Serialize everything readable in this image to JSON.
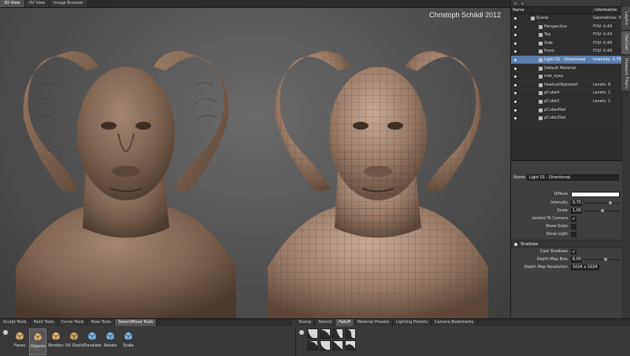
{
  "top_tabs": [
    "3D View",
    "UV View",
    "Image Browser"
  ],
  "active_top_tab": 0,
  "watermark": "Christoph Schädl 2012",
  "outliner": {
    "columns": [
      "Name",
      "Information"
    ],
    "rows": [
      {
        "name": "Scene",
        "info": "Geometries: 3",
        "indent": 0
      },
      {
        "name": "Perspective",
        "info": "FOV: 0.49",
        "indent": 1
      },
      {
        "name": "Top",
        "info": "FOV: 0.49",
        "indent": 1
      },
      {
        "name": "Side",
        "info": "FOV: 0.49",
        "indent": 1
      },
      {
        "name": "Front",
        "info": "FOV: 0.49",
        "indent": 1
      },
      {
        "name": "Light 01 - Directional",
        "info": "Intensity: 0.75",
        "indent": 1,
        "selected": true
      },
      {
        "name": "Default Material",
        "info": "",
        "indent": 1
      },
      {
        "name": "mat_eyes",
        "info": "",
        "indent": 1
      },
      {
        "name": "headusObjexport",
        "info": "Levels: 6",
        "indent": 1
      },
      {
        "name": "pCube4",
        "info": "Levels: 1",
        "indent": 1
      },
      {
        "name": "pCube3",
        "info": "Levels: 1",
        "indent": 1
      },
      {
        "name": "pCube4Set",
        "info": "",
        "indent": 1
      },
      {
        "name": "pCube3Set",
        "info": "",
        "indent": 1
      }
    ]
  },
  "side_tabs": [
    "Layers",
    "Outliner",
    "Viewport Filters"
  ],
  "properties": {
    "name_label": "Name",
    "name_value": "Light 01 - Directional",
    "diffuse_label": "Diffuse",
    "diffuse_color": "#ffffff",
    "intensity_label": "Intensity",
    "intensity_value": "0,75",
    "intensity_fraction": 0.75,
    "scale_label": "Scale",
    "scale_value": "1,00",
    "scale_fraction": 0.5,
    "locked_label": "Locked To Camera",
    "locked_checked": true,
    "show_grips_label": "Show Grips",
    "show_light_label": "Show Light",
    "shadows_section": "Shadows",
    "cast_shadows_label": "Cast Shadows",
    "cast_shadows_checked": true,
    "depth_bias_label": "Depth Map Bias",
    "depth_bias_value": "6,00",
    "depth_bias_fraction": 0.6,
    "depth_res_label": "Depth Map Resolution",
    "depth_res_value": "1024 x 1024"
  },
  "left_tool_tabs": [
    "Sculpt Tools",
    "Paint Tools",
    "Curve Tools",
    "Pose Tools",
    "Select/Move Tools"
  ],
  "active_left_tool_tab": 4,
  "select_tools": [
    "Faces",
    "Objects",
    "Borders",
    "UV Shells",
    "Translate",
    "Rotate",
    "Scale"
  ],
  "active_select_tool": 1,
  "right_tool_tabs": [
    "Stamp",
    "Stencil",
    "Falloff",
    "Material Presets",
    "Lighting Presets",
    "Camera Bookmarks"
  ],
  "active_right_tool_tab": 2
}
